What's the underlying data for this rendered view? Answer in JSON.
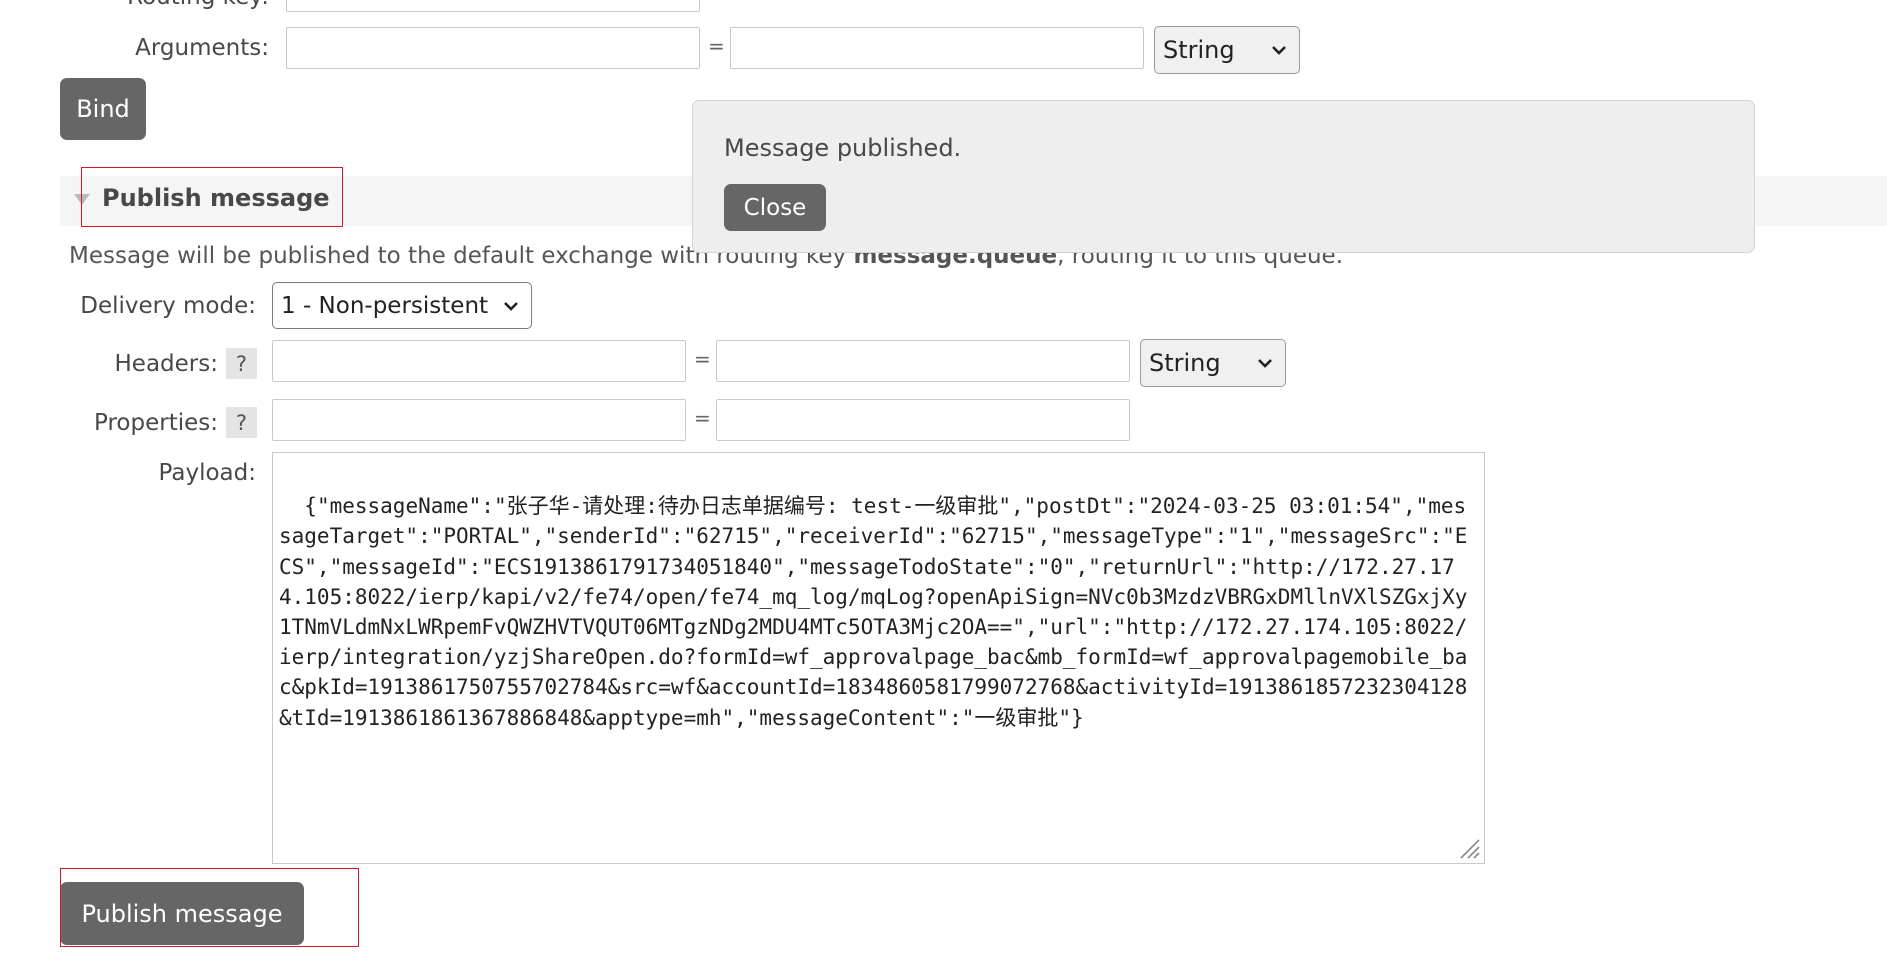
{
  "binding": {
    "routing_key_label": "Routing key:",
    "arguments_label": "Arguments:",
    "arguments_equals": "=",
    "arguments_type": "String",
    "bind_button": "Bind"
  },
  "toast": {
    "message": "Message published.",
    "close_button": "Close"
  },
  "publish": {
    "section_title": "Publish message",
    "description_prefix": "Message will be published to the default exchange with routing key ",
    "routing_key": "message.queue",
    "description_suffix": ", routing it to this queue.",
    "delivery_mode_label": "Delivery mode:",
    "delivery_mode_value": "1 - Non-persistent",
    "headers_label": "Headers:",
    "help_glyph": "?",
    "equals": "=",
    "headers_type": "String",
    "properties_label": "Properties:",
    "payload_label": "Payload:",
    "payload_value": "{\"messageName\":\"张子华-请处理:待办日志单据编号: test-一级审批\",\"postDt\":\"2024-03-25 03:01:54\",\"messageTarget\":\"PORTAL\",\"senderId\":\"62715\",\"receiverId\":\"62715\",\"messageType\":\"1\",\"messageSrc\":\"ECS\",\"messageId\":\"ECS1913861791734051840\",\"messageTodoState\":\"0\",\"returnUrl\":\"http://172.27.174.105:8022/ierp/kapi/v2/fe74/open/fe74_mq_log/mqLog?openApiSign=NVc0b3MzdzVBRGxDMllnVXlSZGxjXy1TNmVLdmNxLWRpemFvQWZHVTVQUT06MTgzNDg2MDU4MTc5OTA3Mjc2OA==\",\"url\":\"http://172.27.174.105:8022/ierp/integration/yzjShareOpen.do?formId=wf_approvalpage_bac&mb_formId=wf_approvalpagemobile_bac&pkId=1913861750755702784&src=wf&accountId=1834860581799072768&activityId=1913861857232304128&tId=1913861861367886848&apptype=mh\",\"messageContent\":\"一级审批\"}",
    "submit_button": "Publish message"
  },
  "icons": {
    "section_toggle": "triangle-down-icon",
    "select_arrow": "chevron-down-icon",
    "resize": "resize-grip-icon"
  },
  "colors": {
    "button_bg": "#666666",
    "toast_bg": "#eeeeee",
    "highlight_border": "#d9181f"
  }
}
